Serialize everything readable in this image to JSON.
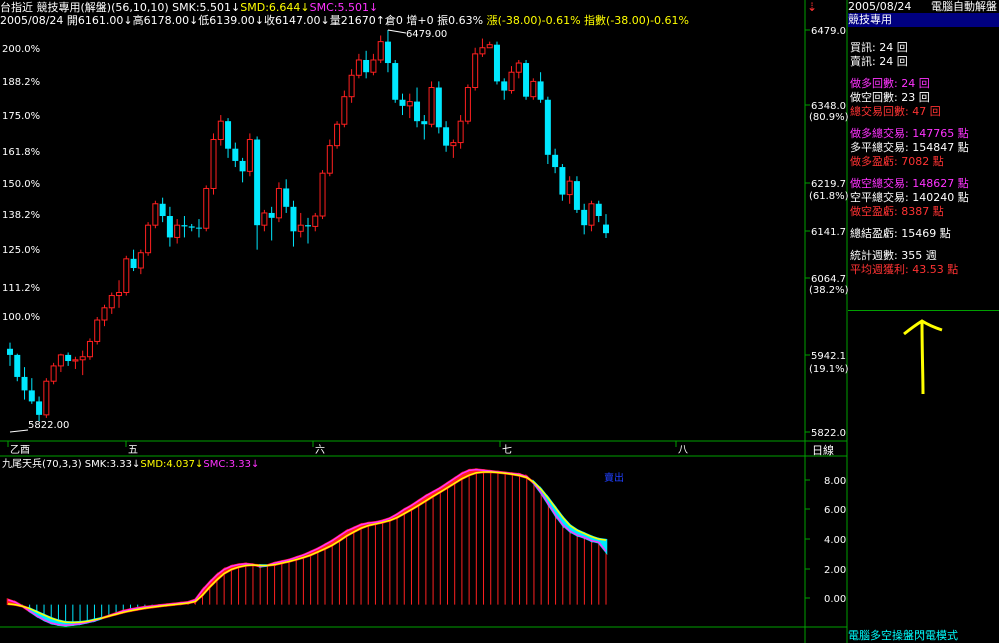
{
  "header": {
    "line1": [
      {
        "text": "台指近  競技專用(解盤)(56,10,10) SMK:5.501↓",
        "color": "#ffffff"
      },
      {
        "text": "SMD:6.644↓",
        "color": "#ffff00"
      },
      {
        "text": "SMC:5.501↓",
        "color": "#ff33ff"
      }
    ],
    "line2": [
      {
        "text": "2005/08/24 開6161.00↓高6178.00↓低6139.00↓收6147.00↓量21670↑倉0 增+0 振0.63% ",
        "color": "#ffffff"
      },
      {
        "text": "漲(-38.00)-0.61%",
        "color": "#ffff00"
      },
      {
        "text": " 指數(-38.00)-0.61%",
        "color": "#ffff00"
      }
    ]
  },
  "top_right": {
    "date": "2005/08/24",
    "title": "電腦自動解盤",
    "tab": "競技專用"
  },
  "stats_panel": [
    {
      "text": "買訊: 24 回",
      "color": "#ffffff",
      "gap": false
    },
    {
      "text": "賣訊: 24 回",
      "color": "#ffffff",
      "gap": false
    },
    {
      "text": "做多回數: 24 回",
      "color": "#ff33ff",
      "gap": true
    },
    {
      "text": "做空回數: 23 回",
      "color": "#ffffff",
      "gap": false
    },
    {
      "text": "總交易回數: 47 回",
      "color": "#ff3333",
      "gap": false
    },
    {
      "text": "做多總交易: 147765 點",
      "color": "#ff33ff",
      "gap": true
    },
    {
      "text": "多平總交易: 154847 點",
      "color": "#ffffff",
      "gap": false
    },
    {
      "text": "做多盈虧: 7082 點",
      "color": "#ff3333",
      "gap": false
    },
    {
      "text": "做空總交易: 148627 點",
      "color": "#ff33ff",
      "gap": true
    },
    {
      "text": "空平總交易: 140240 點",
      "color": "#ffffff",
      "gap": false
    },
    {
      "text": "做空盈虧: 8387 點",
      "color": "#ff3333",
      "gap": false
    },
    {
      "text": "總結盈虧: 15469 點",
      "color": "#ffffff",
      "gap": true
    },
    {
      "text": "統計週數: 355 週",
      "color": "#ffffff",
      "gap": true
    },
    {
      "text": "平均週獲利: 43.53 點",
      "color": "#ff3333",
      "gap": false
    }
  ],
  "bottom_right": "電腦多空操盤閃電模式",
  "chart_data": [
    {
      "type": "candlestick",
      "y_ticks_right": [
        "6479.0",
        "6348.0",
        "6219.7",
        "6141.7",
        "6064.7",
        "5942.1",
        "5822.0"
      ],
      "y_pct_right": [
        "(80.9%)",
        "(61.8%)",
        "(38.2%)",
        "(19.1%)"
      ],
      "y_ticks_left": [
        "200.0%",
        "188.2%",
        "175.0%",
        "161.8%",
        "150.0%",
        "138.2%",
        "125.0%",
        "111.2%",
        "100.0%"
      ],
      "ylim": [
        5822,
        6479
      ],
      "annotations": [
        {
          "text": "6479.00",
          "value": 6479
        },
        {
          "text": "5822.00",
          "value": 5822
        }
      ],
      "x_month_labels": [
        "乙酉",
        "五",
        "六",
        "七",
        "八"
      ],
      "period_label": "日線",
      "candles": [
        [
          5958,
          5968,
          5930,
          5948
        ],
        [
          5948,
          5950,
          5905,
          5912
        ],
        [
          5912,
          5928,
          5875,
          5890
        ],
        [
          5890,
          5910,
          5868,
          5872
        ],
        [
          5872,
          5880,
          5840,
          5850
        ],
        [
          5850,
          5910,
          5845,
          5905
        ],
        [
          5905,
          5935,
          5900,
          5930
        ],
        [
          5930,
          5950,
          5920,
          5948
        ],
        [
          5948,
          5952,
          5930,
          5938
        ],
        [
          5938,
          5945,
          5925,
          5940
        ],
        [
          5940,
          5955,
          5915,
          5945
        ],
        [
          5945,
          5975,
          5940,
          5970
        ],
        [
          5970,
          6010,
          5965,
          6005
        ],
        [
          6005,
          6030,
          5995,
          6025
        ],
        [
          6025,
          6050,
          6015,
          6045
        ],
        [
          6045,
          6070,
          6025,
          6050
        ],
        [
          6050,
          6110,
          6045,
          6105
        ],
        [
          6105,
          6120,
          6085,
          6090
        ],
        [
          6090,
          6120,
          6080,
          6115
        ],
        [
          6115,
          6165,
          6110,
          6160
        ],
        [
          6160,
          6200,
          6155,
          6195
        ],
        [
          6195,
          6205,
          6165,
          6175
        ],
        [
          6175,
          6190,
          6125,
          6140
        ],
        [
          6140,
          6170,
          6130,
          6160
        ],
        [
          6160,
          6175,
          6140,
          6158
        ],
        [
          6158,
          6162,
          6150,
          6156
        ],
        [
          6156,
          6170,
          6140,
          6155
        ],
        [
          6155,
          6225,
          6150,
          6220
        ],
        [
          6220,
          6310,
          6210,
          6300
        ],
        [
          6300,
          6340,
          6290,
          6330
        ],
        [
          6330,
          6335,
          6270,
          6285
        ],
        [
          6285,
          6295,
          6255,
          6265
        ],
        [
          6265,
          6270,
          6230,
          6248
        ],
        [
          6248,
          6310,
          6240,
          6300
        ],
        [
          6300,
          6305,
          6120,
          6160
        ],
        [
          6160,
          6185,
          6150,
          6180
        ],
        [
          6180,
          6190,
          6135,
          6172
        ],
        [
          6172,
          6230,
          6165,
          6220
        ],
        [
          6220,
          6235,
          6180,
          6190
        ],
        [
          6190,
          6200,
          6125,
          6150
        ],
        [
          6150,
          6180,
          6140,
          6160
        ],
        [
          6160,
          6172,
          6130,
          6158
        ],
        [
          6158,
          6180,
          6150,
          6175
        ],
        [
          6175,
          6250,
          6170,
          6245
        ],
        [
          6245,
          6300,
          6240,
          6290
        ],
        [
          6290,
          6330,
          6285,
          6325
        ],
        [
          6325,
          6380,
          6320,
          6370
        ],
        [
          6370,
          6415,
          6360,
          6405
        ],
        [
          6405,
          6440,
          6400,
          6430
        ],
        [
          6430,
          6445,
          6400,
          6410
        ],
        [
          6410,
          6440,
          6405,
          6430
        ],
        [
          6430,
          6470,
          6425,
          6460
        ],
        [
          6460,
          6479,
          6410,
          6425
        ],
        [
          6425,
          6430,
          6360,
          6365
        ],
        [
          6365,
          6375,
          6340,
          6355
        ],
        [
          6355,
          6375,
          6335,
          6362
        ],
        [
          6362,
          6385,
          6320,
          6330
        ],
        [
          6330,
          6340,
          6300,
          6325
        ],
        [
          6325,
          6395,
          6320,
          6385
        ],
        [
          6385,
          6395,
          6310,
          6320
        ],
        [
          6320,
          6330,
          6280,
          6290
        ],
        [
          6290,
          6300,
          6270,
          6295
        ],
        [
          6295,
          6340,
          6285,
          6330
        ],
        [
          6330,
          6390,
          6325,
          6385
        ],
        [
          6385,
          6450,
          6380,
          6440
        ],
        [
          6440,
          6465,
          6435,
          6450
        ],
        [
          6450,
          6460,
          6450,
          6455
        ],
        [
          6455,
          6460,
          6390,
          6395
        ],
        [
          6395,
          6400,
          6365,
          6380
        ],
        [
          6380,
          6420,
          6375,
          6410
        ],
        [
          6410,
          6430,
          6400,
          6425
        ],
        [
          6425,
          6430,
          6365,
          6370
        ],
        [
          6370,
          6400,
          6365,
          6395
        ],
        [
          6395,
          6410,
          6360,
          6365
        ],
        [
          6365,
          6370,
          6260,
          6275
        ],
        [
          6275,
          6285,
          6245,
          6255
        ],
        [
          6255,
          6260,
          6200,
          6210
        ],
        [
          6210,
          6240,
          6195,
          6232
        ],
        [
          6232,
          6240,
          6180,
          6185
        ],
        [
          6185,
          6195,
          6145,
          6160
        ],
        [
          6160,
          6200,
          6150,
          6195
        ],
        [
          6195,
          6200,
          6165,
          6175
        ],
        [
          6161,
          6178,
          6139,
          6147
        ]
      ]
    },
    {
      "type": "oscillator",
      "title": [
        {
          "text": "九尾天兵(70,3,3) SMK:3.33↓",
          "color": "#ffffff"
        },
        {
          "text": "SMD:4.037↓",
          "color": "#ffff00"
        },
        {
          "text": "SMC:3.33↓",
          "color": "#ff33ff"
        }
      ],
      "signal_label": "賣出",
      "y_ticks": [
        "8.00",
        "6.00",
        "4.00",
        "2.00",
        "0.00"
      ],
      "ylim": [
        -1.4,
        9.3
      ],
      "smk": [
        0.3,
        0.15,
        -0.1,
        -0.4,
        -0.7,
        -0.95,
        -1.15,
        -1.25,
        -1.3,
        -1.25,
        -1.2,
        -1.1,
        -1.0,
        -0.85,
        -0.7,
        -0.55,
        -0.4,
        -0.3,
        -0.22,
        -0.15,
        -0.1,
        -0.05,
        0.0,
        0.05,
        0.1,
        0.15,
        0.3,
        0.9,
        1.4,
        1.85,
        2.2,
        2.4,
        2.5,
        2.55,
        2.5,
        2.4,
        2.45,
        2.6,
        2.7,
        2.8,
        2.95,
        3.1,
        3.3,
        3.5,
        3.75,
        4.0,
        4.3,
        4.6,
        4.8,
        5.0,
        5.1,
        5.15,
        5.25,
        5.4,
        5.65,
        5.95,
        6.2,
        6.5,
        6.8,
        7.05,
        7.3,
        7.6,
        7.9,
        8.2,
        8.4,
        8.45,
        8.4,
        8.35,
        8.3,
        8.25,
        8.2,
        8.15,
        8.0,
        7.6,
        7.0,
        6.3,
        5.6,
        5.0,
        4.6,
        4.35,
        4.2,
        4.0,
        3.9,
        3.33
      ],
      "smd": [
        0.05,
        0.0,
        -0.1,
        -0.25,
        -0.45,
        -0.65,
        -0.85,
        -1.0,
        -1.1,
        -1.12,
        -1.1,
        -1.05,
        -0.95,
        -0.85,
        -0.72,
        -0.6,
        -0.48,
        -0.38,
        -0.3,
        -0.22,
        -0.16,
        -0.1,
        -0.05,
        0.0,
        0.05,
        0.1,
        0.2,
        0.6,
        1.1,
        1.55,
        1.95,
        2.2,
        2.35,
        2.45,
        2.48,
        2.45,
        2.45,
        2.5,
        2.6,
        2.7,
        2.82,
        2.95,
        3.1,
        3.3,
        3.5,
        3.72,
        4.0,
        4.3,
        4.55,
        4.78,
        4.95,
        5.05,
        5.15,
        5.27,
        5.45,
        5.7,
        5.95,
        6.22,
        6.5,
        6.78,
        7.05,
        7.32,
        7.6,
        7.88,
        8.1,
        8.25,
        8.3,
        8.3,
        8.27,
        8.22,
        8.16,
        8.08,
        7.95,
        7.65,
        7.2,
        6.65,
        6.05,
        5.45,
        4.95,
        4.65,
        4.45,
        4.25,
        4.1,
        4.037
      ]
    }
  ]
}
